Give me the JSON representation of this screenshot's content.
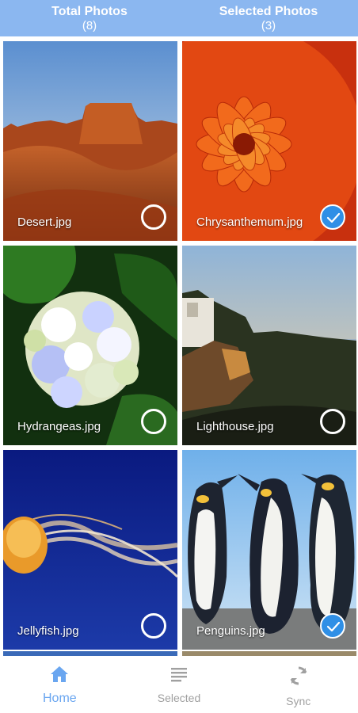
{
  "header": {
    "total_label": "Total Photos",
    "total_count": "(8)",
    "selected_label": "Selected Photos",
    "selected_count": "(3)"
  },
  "photos": [
    {
      "name": "Desert.jpg",
      "selected": false
    },
    {
      "name": "Chrysanthemum.jpg",
      "selected": true
    },
    {
      "name": "Hydrangeas.jpg",
      "selected": false
    },
    {
      "name": "Lighthouse.jpg",
      "selected": false
    },
    {
      "name": "Jellyfish.jpg",
      "selected": false
    },
    {
      "name": "Penguins.jpg",
      "selected": true
    }
  ],
  "nav": {
    "home": {
      "label": "Home",
      "icon": "home-icon"
    },
    "selected": {
      "label": "Selected",
      "icon": "list-icon"
    },
    "sync": {
      "label": "Sync",
      "icon": "sync-icon"
    }
  },
  "colors": {
    "header_bg": "#8bb7f0",
    "accent": "#2f8fe6",
    "nav_active": "#6aa6f0",
    "nav_inactive": "#a0a0a0"
  }
}
